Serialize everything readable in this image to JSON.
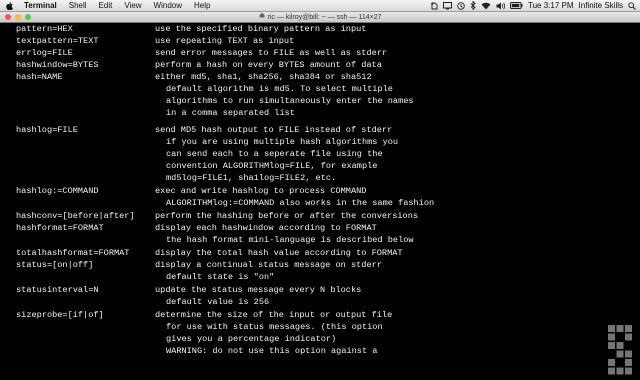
{
  "menubar": {
    "apple_icon": "apple-logo-icon",
    "items": [
      {
        "label": "Terminal"
      },
      {
        "label": "Shell"
      },
      {
        "label": "Edit"
      },
      {
        "label": "View"
      },
      {
        "label": "Window"
      },
      {
        "label": "Help"
      }
    ],
    "tray_icons": [
      "evernote-icon",
      "display-icon",
      "time-machine-icon",
      "bluetooth-icon",
      "wifi-icon",
      "volume-icon",
      "battery-icon"
    ],
    "clock": "Tue 3:17 PM",
    "user": "Infinite Skills",
    "search_icon": "spotlight-icon"
  },
  "window": {
    "title": "ric — kilroy@bill: ~ — ssh — 114×27"
  },
  "terminal": {
    "lines": [
      {
        "opt": "pattern=HEX",
        "desc": "use the specified binary pattern as input"
      },
      {
        "opt": "textpattern=TEXT",
        "desc": "use repeating TEXT as input"
      },
      {
        "opt": "errlog=FILE",
        "desc": "send error messages to FILE as well as stderr"
      },
      {
        "opt": "hashwindow=BYTES",
        "desc": "perform a hash on every BYTES amount of data"
      },
      {
        "opt": "hash=NAME",
        "desc": "either md5, sha1, sha256, sha384 or sha512"
      },
      {
        "opt": "",
        "desc": "default algorithm is md5. To select multiple",
        "indent": true
      },
      {
        "opt": "",
        "desc": "algorithms to run simultaneously enter the names",
        "indent": true
      },
      {
        "opt": "",
        "desc": "in a comma separated list",
        "indent": true
      },
      {
        "opt": "hashlog=FILE",
        "desc": "send MD5 hash output to FILE instead of stderr"
      },
      {
        "opt": "",
        "desc": "if you are using multiple hash algorithms you",
        "indent": true
      },
      {
        "opt": "",
        "desc": "can send each to a seperate file using the",
        "indent": true
      },
      {
        "opt": "",
        "desc": "convention ALGORITHMlog=FILE, for example",
        "indent": true
      },
      {
        "opt": "",
        "desc": "md5log=FILE1, sha1log=FILE2, etc.",
        "indent": true
      },
      {
        "opt": "hashlog:=COMMAND",
        "desc": "exec and write hashlog to process COMMAND"
      },
      {
        "opt": "",
        "desc": "ALGORITHMlog:=COMMAND also works in the same fashion",
        "indent": true
      },
      {
        "opt": "hashconv=[before|after]",
        "desc": "perform the hashing before or after the conversions"
      },
      {
        "opt": "hashformat=FORMAT",
        "desc": "display each hashwindow according to FORMAT"
      },
      {
        "opt": "",
        "desc": "the hash format mini-language is described below",
        "indent": true
      },
      {
        "opt": "totalhashformat=FORMAT",
        "desc": "display the total hash value according to FORMAT"
      },
      {
        "opt": "status=[on|off]",
        "desc": "display a continual status message on stderr"
      },
      {
        "opt": "",
        "desc": "default state is \"on\"",
        "indent": true
      },
      {
        "opt": "statusinterval=N",
        "desc": "update the status message every N blocks"
      },
      {
        "opt": "",
        "desc": "default value is 256",
        "indent": true
      },
      {
        "opt": "sizeprobe=[if|of]",
        "desc": "determine the size of the input or output file"
      },
      {
        "opt": "",
        "desc": "for use with status messages. (this option",
        "indent": true
      },
      {
        "opt": "",
        "desc": "gives you a percentage indicator)",
        "indent": true
      },
      {
        "opt": "",
        "desc": "WARNING: do not use this option against a",
        "indent": true
      }
    ]
  },
  "watermark_icon": "infinite-skills-logo-icon"
}
